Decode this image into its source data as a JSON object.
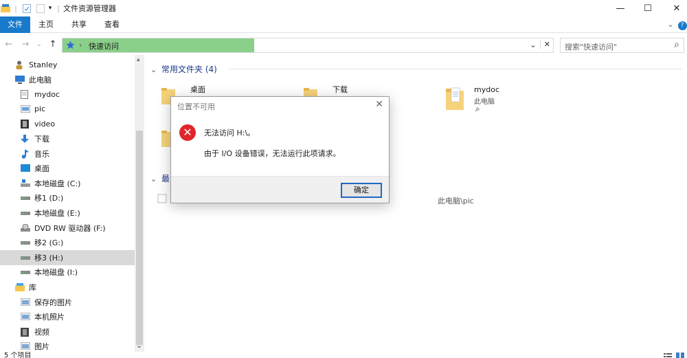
{
  "window": {
    "title": "文件资源管理器",
    "minimize_glyph": "—",
    "maximize_glyph": "☐",
    "close_glyph": "✕",
    "qa_divider": "|",
    "qa_dropdown_glyph": "▾"
  },
  "ribbon": {
    "tabs": [
      "文件",
      "主页",
      "共享",
      "查看"
    ],
    "expand_glyph": "⌄",
    "help_glyph": "?"
  },
  "nav": {
    "back": "←",
    "forward": "→",
    "recent": "⌄",
    "up": "↑"
  },
  "address": {
    "separator": "›",
    "path": "快速访问",
    "dropdown_glyph": "⌄",
    "clear_glyph": "✕"
  },
  "search": {
    "placeholder": "搜索\"快速访问\"",
    "icon_glyph": "⌕"
  },
  "sidebar": {
    "items": [
      {
        "label": "Stanley",
        "icon": "user-icon",
        "indent": 22
      },
      {
        "label": "此电脑",
        "icon": "computer-icon",
        "indent": 22
      },
      {
        "label": "mydoc",
        "icon": "document-icon",
        "indent": 30
      },
      {
        "label": "pic",
        "icon": "image-folder-icon",
        "indent": 30
      },
      {
        "label": "video",
        "icon": "video-folder-icon",
        "indent": 30
      },
      {
        "label": "下载",
        "icon": "download-icon",
        "indent": 30
      },
      {
        "label": "音乐",
        "icon": "music-icon",
        "indent": 30
      },
      {
        "label": "桌面",
        "icon": "desktop-icon",
        "indent": 30
      },
      {
        "label": "本地磁盘 (C:)",
        "icon": "system-drive-icon",
        "indent": 30
      },
      {
        "label": "移1 (D:)",
        "icon": "drive-icon",
        "indent": 30
      },
      {
        "label": "本地磁盘 (E:)",
        "icon": "drive-icon",
        "indent": 30
      },
      {
        "label": "DVD RW 驱动器 (F:)",
        "icon": "dvd-drive-icon",
        "indent": 30
      },
      {
        "label": "移2 (G:)",
        "icon": "drive-icon",
        "indent": 30
      },
      {
        "label": "移3 (H:)",
        "icon": "drive-icon",
        "indent": 30,
        "selected": true
      },
      {
        "label": "本地磁盘 (I:)",
        "icon": "drive-icon",
        "indent": 30
      },
      {
        "label": "库",
        "icon": "library-icon",
        "indent": 22
      },
      {
        "label": "保存的图片",
        "icon": "picture-library-icon",
        "indent": 30
      },
      {
        "label": "本机照片",
        "icon": "picture-library-icon",
        "indent": 30
      },
      {
        "label": "视频",
        "icon": "video-library-icon",
        "indent": 30
      },
      {
        "label": "图片",
        "icon": "picture-library-icon",
        "indent": 30
      }
    ],
    "scroll_up": "▴",
    "scroll_down": "⌄"
  },
  "main": {
    "frequent_header": "常用文件夹 (4)",
    "recent_header": "最",
    "collapse_glyph": "⌄",
    "folders": [
      {
        "name": "桌面",
        "sub": ""
      },
      {
        "name": "下载",
        "sub": ""
      },
      {
        "name": "mydoc",
        "sub": "此电脑"
      }
    ],
    "recent_path": "此电脑\\pic"
  },
  "dialog": {
    "title": "位置不可用",
    "close_glyph": "✕",
    "error_glyph": "✕",
    "message": "无法访问 H:\\。",
    "detail": "由于 I/O 设备错误，无法运行此项请求。",
    "ok": "确定"
  },
  "statusbar": {
    "items_text": "5 个项目"
  },
  "colors": {
    "accent": "#1979ca",
    "address_fill": "#8ad08a",
    "error_red": "#e0262b",
    "folder_yellow": "#f6d37a"
  }
}
